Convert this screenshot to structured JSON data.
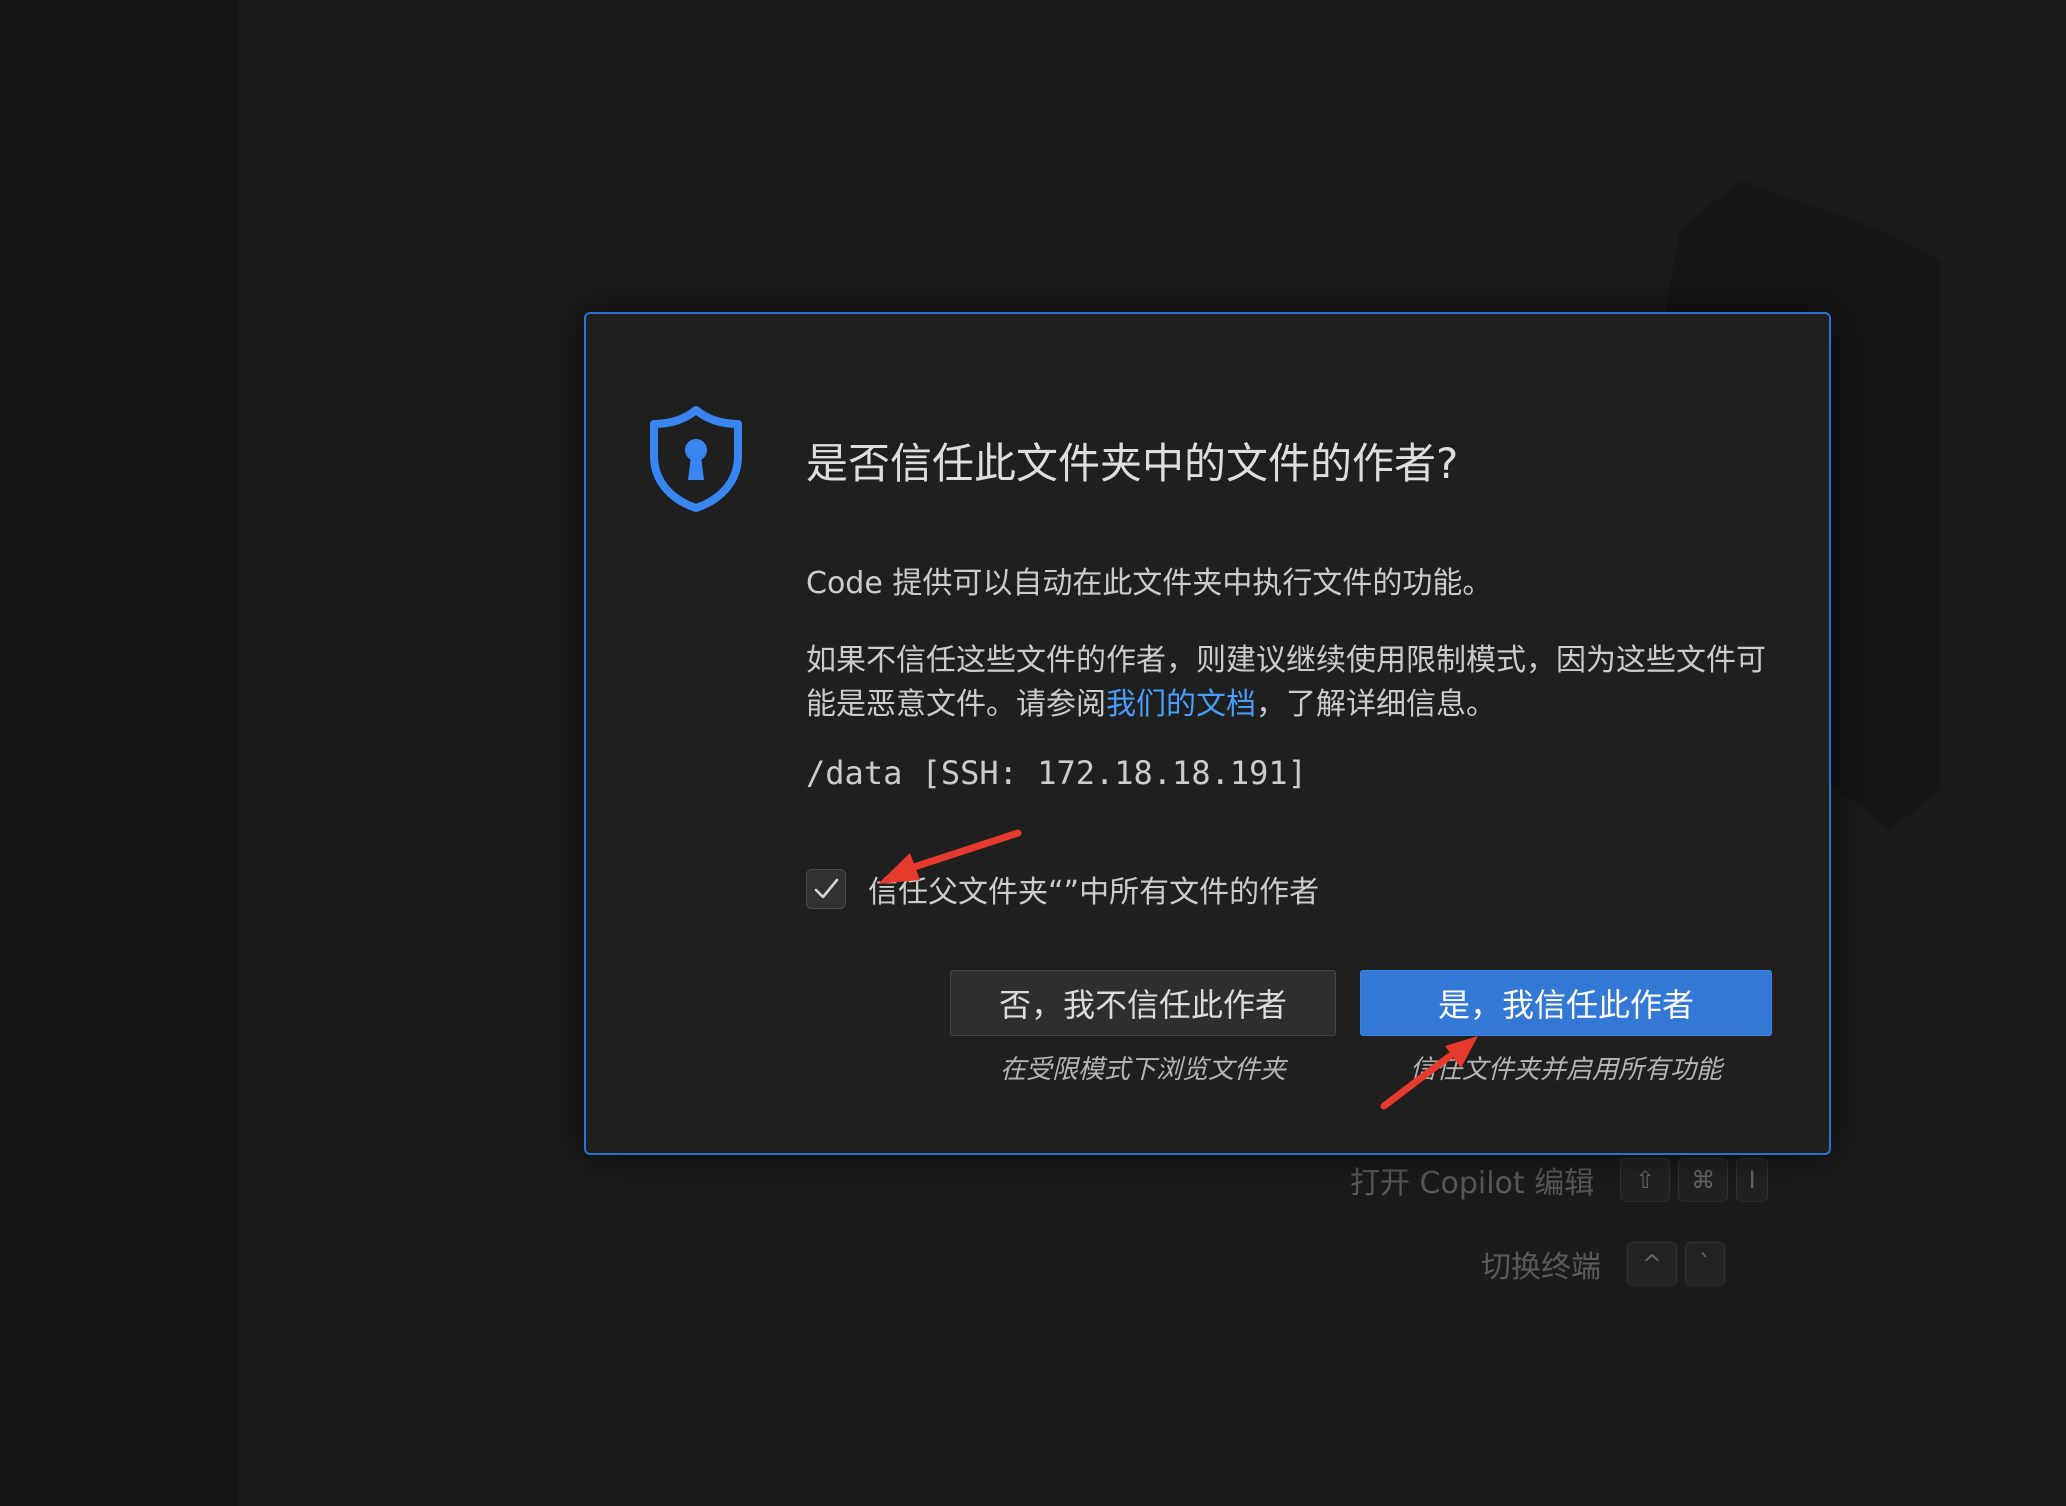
{
  "dialog": {
    "title": "是否信任此文件夹中的文件的作者?",
    "paragraph1": "Code 提供可以自动在此文件夹中执行文件的功能。",
    "paragraph2_prefix": "如果不信任这些文件的作者，则建议继续使用限制模式，因为这些文件可能是恶意文件。请参阅",
    "paragraph2_link": "我们的文档",
    "paragraph2_suffix": "，了解详细信息。",
    "path": "/data [SSH: 172.18.18.191]",
    "checkbox_label": "信任父文件夹“”中所有文件的作者",
    "checkbox_checked": true,
    "no_button": "否，我不信任此作者",
    "no_description": "在受限模式下浏览文件夹",
    "yes_button": "是，我信任此作者",
    "yes_description": "信任文件夹并启用所有功能",
    "accent_color": "#3478d6",
    "border_color": "#2b72d6",
    "link_color": "#4a9df8"
  },
  "hints": [
    {
      "label": "打开 Copilot 编辑",
      "keys": [
        "⇧",
        "⌘",
        "I"
      ]
    },
    {
      "label": "切换终端",
      "keys": [
        "^",
        "`"
      ]
    }
  ],
  "icons": {
    "dialog_icon": "shield-keyhole-icon",
    "checkbox_icon": "checkmark-icon",
    "annotation": "red-arrow"
  },
  "annotation_color": "#e63a2e"
}
